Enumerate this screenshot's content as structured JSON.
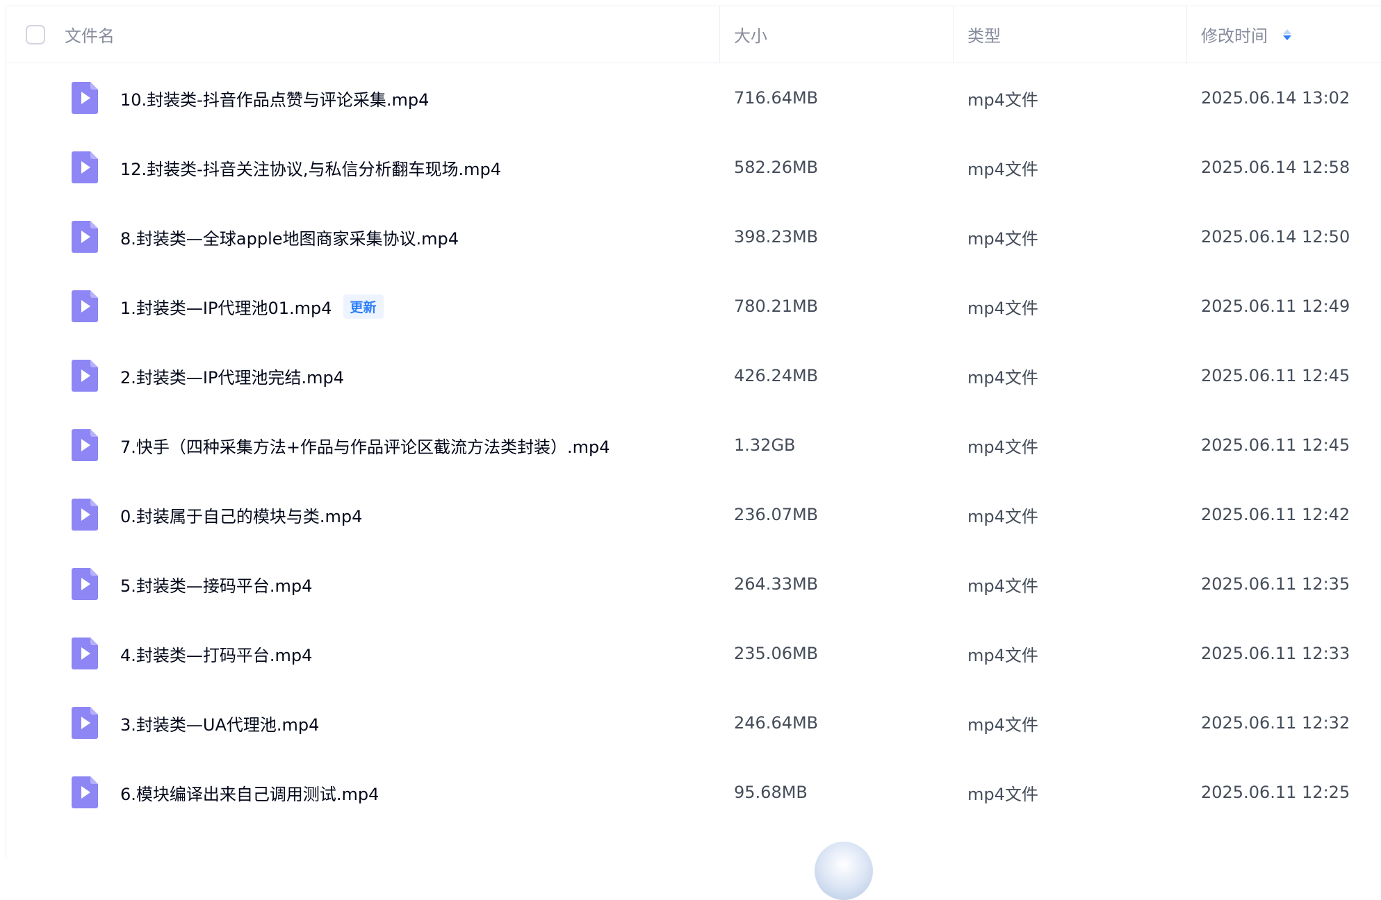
{
  "header": {
    "name_label": "文件名",
    "size_label": "大小",
    "type_label": "类型",
    "time_label": "修改时间"
  },
  "colors": {
    "accent": "#2d7ff9",
    "file_icon": "#8d86f4",
    "border": "#eef0f6",
    "muted_text": "#878c9c"
  },
  "icons": {
    "file": "video-file-icon",
    "sort": "sort-icon"
  },
  "files": [
    {
      "name": "10.封装类-抖音作品点赞与评论采集.mp4",
      "badge": "",
      "size": "716.64MB",
      "type": "mp4文件",
      "time": "2025.06.14 13:02"
    },
    {
      "name": "12.封装类-抖音关注协议,与私信分析翻车现场.mp4",
      "badge": "",
      "size": "582.26MB",
      "type": "mp4文件",
      "time": "2025.06.14 12:58"
    },
    {
      "name": "8.封装类—全球apple地图商家采集协议.mp4",
      "badge": "",
      "size": "398.23MB",
      "type": "mp4文件",
      "time": "2025.06.14 12:50"
    },
    {
      "name": "1.封装类—IP代理池01.mp4",
      "badge": "更新",
      "size": "780.21MB",
      "type": "mp4文件",
      "time": "2025.06.11 12:49"
    },
    {
      "name": "2.封装类—IP代理池完结.mp4",
      "badge": "",
      "size": "426.24MB",
      "type": "mp4文件",
      "time": "2025.06.11 12:45"
    },
    {
      "name": "7.快手（四种采集方法+作品与作品评论区截流方法类封装）.mp4",
      "badge": "",
      "size": "1.32GB",
      "type": "mp4文件",
      "time": "2025.06.11 12:45"
    },
    {
      "name": "0.封装属于自己的模块与类.mp4",
      "badge": "",
      "size": "236.07MB",
      "type": "mp4文件",
      "time": "2025.06.11 12:42"
    },
    {
      "name": "5.封装类—接码平台.mp4",
      "badge": "",
      "size": "264.33MB",
      "type": "mp4文件",
      "time": "2025.06.11 12:35"
    },
    {
      "name": "4.封装类—打码平台.mp4",
      "badge": "",
      "size": "235.06MB",
      "type": "mp4文件",
      "time": "2025.06.11 12:33"
    },
    {
      "name": "3.封装类—UA代理池.mp4",
      "badge": "",
      "size": "246.64MB",
      "type": "mp4文件",
      "time": "2025.06.11 12:32"
    },
    {
      "name": "6.模块编译出来自己调用测试.mp4",
      "badge": "",
      "size": "95.68MB",
      "type": "mp4文件",
      "time": "2025.06.11 12:25"
    }
  ]
}
